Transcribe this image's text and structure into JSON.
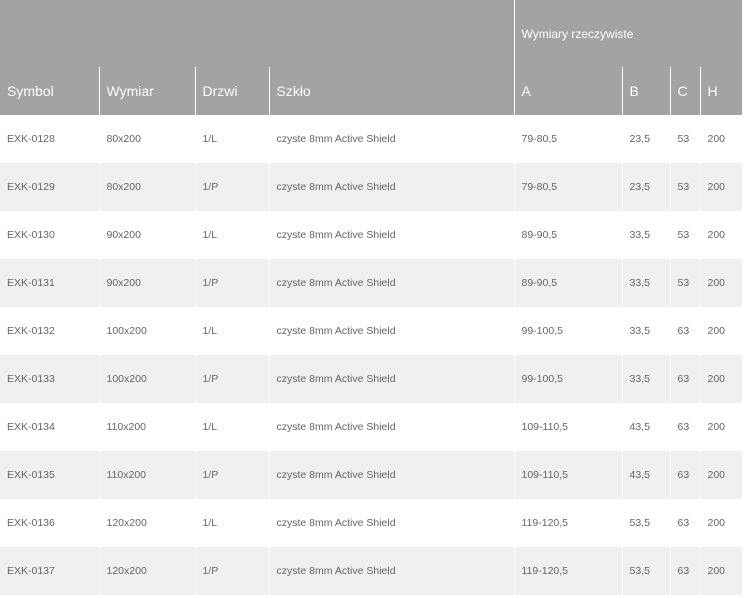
{
  "table": {
    "group_header": "Wymiary rzeczywiste",
    "columns": [
      "Symbol",
      "Wymiar",
      "Drzwi",
      "Szkło",
      "A",
      "B",
      "C",
      "H"
    ],
    "rows": [
      [
        "EXK-0128",
        "80x200",
        "1/L",
        "czyste 8mm Active Shield",
        "79-80,5",
        "23,5",
        "53",
        "200"
      ],
      [
        "EXK-0129",
        "80x200",
        "1/P",
        "czyste 8mm Active Shield",
        "79-80,5",
        "23,5",
        "53",
        "200"
      ],
      [
        "EXK-0130",
        "90x200",
        "1/L",
        "czyste 8mm Active Shield",
        "89-90,5",
        "33,5",
        "53",
        "200"
      ],
      [
        "EXK-0131",
        "90x200",
        "1/P",
        "czyste 8mm Active Shield",
        "89-90,5",
        "33,5",
        "53",
        "200"
      ],
      [
        "EXK-0132",
        "100x200",
        "1/L",
        "czyste 8mm Active Shield",
        "99-100,5",
        "33,5",
        "63",
        "200"
      ],
      [
        "EXK-0133",
        "100x200",
        "1/P",
        "czyste 8mm Active Shield",
        "99-100,5",
        "33,5",
        "63",
        "200"
      ],
      [
        "EXK-0134",
        "110x200",
        "1/L",
        "czyste 8mm Active Shield",
        "109-110,5",
        "43,5",
        "63",
        "200"
      ],
      [
        "EXK-0135",
        "110x200",
        "1/P",
        "czyste 8mm Active Shield",
        "109-110,5",
        "43,5",
        "63",
        "200"
      ],
      [
        "EXK-0136",
        "120x200",
        "1/L",
        "czyste 8mm Active Shield",
        "119-120,5",
        "53,5",
        "63",
        "200"
      ],
      [
        "EXK-0137",
        "120x200",
        "1/P",
        "czyste 8mm Active Shield",
        "119-120,5",
        "53,5",
        "63",
        "200"
      ]
    ]
  }
}
